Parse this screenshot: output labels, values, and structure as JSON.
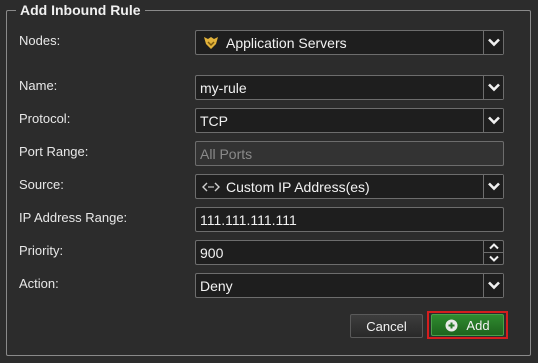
{
  "dialog": {
    "title": "Add Inbound Rule"
  },
  "labels": {
    "nodes": "Nodes:",
    "name": "Name:",
    "protocol": "Protocol:",
    "port_range": "Port Range:",
    "source": "Source:",
    "ip_range": "IP Address Range:",
    "priority": "Priority:",
    "action": "Action:"
  },
  "fields": {
    "nodes": "Application Servers",
    "name": "my-rule",
    "protocol": "TCP",
    "port_range_placeholder": "All Ports",
    "source": "Custom IP Address(es)",
    "ip_range": "111.111.111.111",
    "priority": "900",
    "action": "Deny"
  },
  "buttons": {
    "cancel": "Cancel",
    "add": "Add"
  },
  "colors": {
    "accent_green": "#2f8a2f",
    "highlight_red": "#d41e1e",
    "nodes_icon": "#e2b23a"
  },
  "icons": {
    "nodes": "app-servers-icon",
    "source": "ip-address-icon",
    "dropdown": "chevron-down-icon",
    "add": "plus-circle-icon"
  }
}
